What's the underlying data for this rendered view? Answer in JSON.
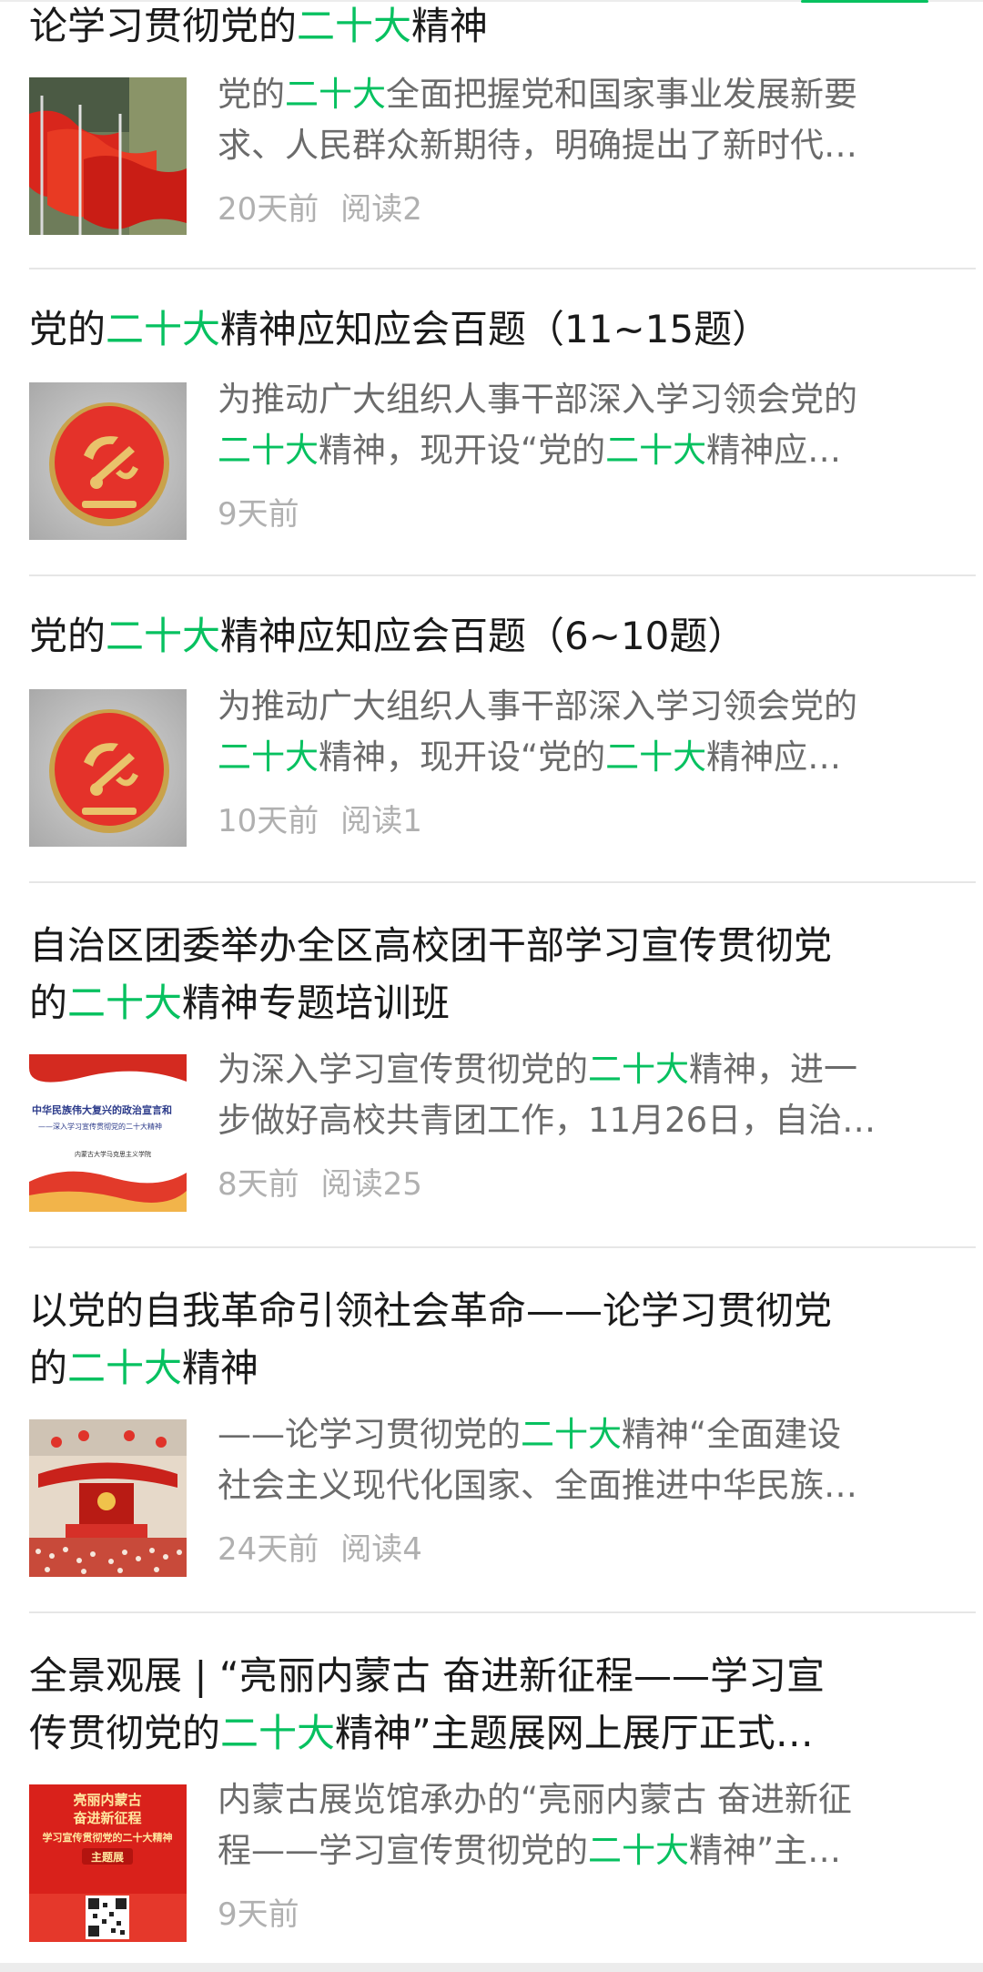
{
  "articles": [
    {
      "title_lines": [
        [
          {
            "t": "论学习贯彻党的",
            "hl": false
          },
          {
            "t": "二十大",
            "hl": true
          },
          {
            "t": "精神",
            "hl": false
          }
        ]
      ],
      "summary_lines": [
        [
          {
            "t": "党的",
            "hl": false
          },
          {
            "t": "二十大",
            "hl": true
          },
          {
            "t": "全面把握党和国家事业发展新要",
            "hl": false
          }
        ],
        [
          {
            "t": "求、人民群众新期待，明确提出了新时代…",
            "hl": false
          }
        ]
      ],
      "time": "20天前",
      "reads": "阅读2",
      "thumb_icon": "red-flags-thumbnail"
    },
    {
      "title_lines": [
        [
          {
            "t": "党的",
            "hl": false
          },
          {
            "t": "二十大",
            "hl": true
          },
          {
            "t": "精神应知应会百题（11~15题）",
            "hl": false
          }
        ]
      ],
      "summary_lines": [
        [
          {
            "t": "为推动广大组织人事干部深入学习领会党的",
            "hl": false
          }
        ],
        [
          {
            "t": "二十大",
            "hl": true
          },
          {
            "t": "精神，现开设“党的",
            "hl": false
          },
          {
            "t": "二十大",
            "hl": true
          },
          {
            "t": "精神应…",
            "hl": false
          }
        ]
      ],
      "time": "9天前",
      "reads": "",
      "thumb_icon": "party-badge-thumbnail"
    },
    {
      "title_lines": [
        [
          {
            "t": "党的",
            "hl": false
          },
          {
            "t": "二十大",
            "hl": true
          },
          {
            "t": "精神应知应会百题（6~10题）",
            "hl": false
          }
        ]
      ],
      "summary_lines": [
        [
          {
            "t": "为推动广大组织人事干部深入学习领会党的",
            "hl": false
          }
        ],
        [
          {
            "t": "二十大",
            "hl": true
          },
          {
            "t": "精神，现开设“党的",
            "hl": false
          },
          {
            "t": "二十大",
            "hl": true
          },
          {
            "t": "精神应…",
            "hl": false
          }
        ]
      ],
      "time": "10天前",
      "reads": "阅读1",
      "thumb_icon": "party-badge-thumbnail"
    },
    {
      "title_lines": [
        [
          {
            "t": "自治区团委举办全区高校团干部学习宣传贯彻党",
            "hl": false
          }
        ],
        [
          {
            "t": "的",
            "hl": false
          },
          {
            "t": "二十大",
            "hl": true
          },
          {
            "t": "精神专题培训班",
            "hl": false
          }
        ]
      ],
      "summary_lines": [
        [
          {
            "t": "为深入学习宣传贯彻党的",
            "hl": false
          },
          {
            "t": "二十大",
            "hl": true
          },
          {
            "t": "精神，进一",
            "hl": false
          }
        ],
        [
          {
            "t": "步做好高校共青团工作，11月26日，自治…",
            "hl": false
          }
        ]
      ],
      "time": "8天前",
      "reads": "阅读25",
      "thumb_icon": "slide-thumbnail"
    },
    {
      "title_lines": [
        [
          {
            "t": "以党的自我革命引领社会革命——论学习贯彻党",
            "hl": false
          }
        ],
        [
          {
            "t": "的",
            "hl": false
          },
          {
            "t": "二十大",
            "hl": true
          },
          {
            "t": "精神",
            "hl": false
          }
        ]
      ],
      "summary_lines": [
        [
          {
            "t": "——论学习贯彻党的",
            "hl": false
          },
          {
            "t": "二十大",
            "hl": true
          },
          {
            "t": "精神“全面建设",
            "hl": false
          }
        ],
        [
          {
            "t": "社会主义现代化国家、全面推进中华民族…",
            "hl": false
          }
        ]
      ],
      "time": "24天前",
      "reads": "阅读4",
      "thumb_icon": "congress-hall-thumbnail"
    },
    {
      "title_lines": [
        [
          {
            "t": "全景观展 | “亮丽内蒙古 奋进新征程——学习宣",
            "hl": false
          }
        ],
        [
          {
            "t": "传贯彻党的",
            "hl": false
          },
          {
            "t": "二十大",
            "hl": true
          },
          {
            "t": "精神”主题展网上展厅正式…",
            "hl": false
          }
        ]
      ],
      "summary_lines": [
        [
          {
            "t": "内蒙古展览馆承办的“亮丽内蒙古 奋进新征",
            "hl": false
          }
        ],
        [
          {
            "t": "程——学习宣传贯彻党的",
            "hl": false
          },
          {
            "t": "二十大",
            "hl": true
          },
          {
            "t": "精神”主…",
            "hl": false
          }
        ]
      ],
      "time": "9天前",
      "reads": "",
      "thumb_icon": "exhibition-poster-thumbnail"
    }
  ],
  "thumb_text": {
    "slide_line1": "中华民族伟大复兴的政治宣言和",
    "slide_line2": "——深入学习宣传贯彻党的二十大精神",
    "slide_line3": "内蒙古大学马克思主义学院",
    "poster_line1": "亮丽内蒙古",
    "poster_line2": "奋进新征程",
    "poster_line3": "学习宣传贯彻党的二十大精神",
    "poster_line4": "主题展"
  },
  "colors": {
    "highlight": "#07c160",
    "title": "#1a1a1a",
    "summary": "#6b6b6b",
    "meta": "#b0b0b0"
  }
}
